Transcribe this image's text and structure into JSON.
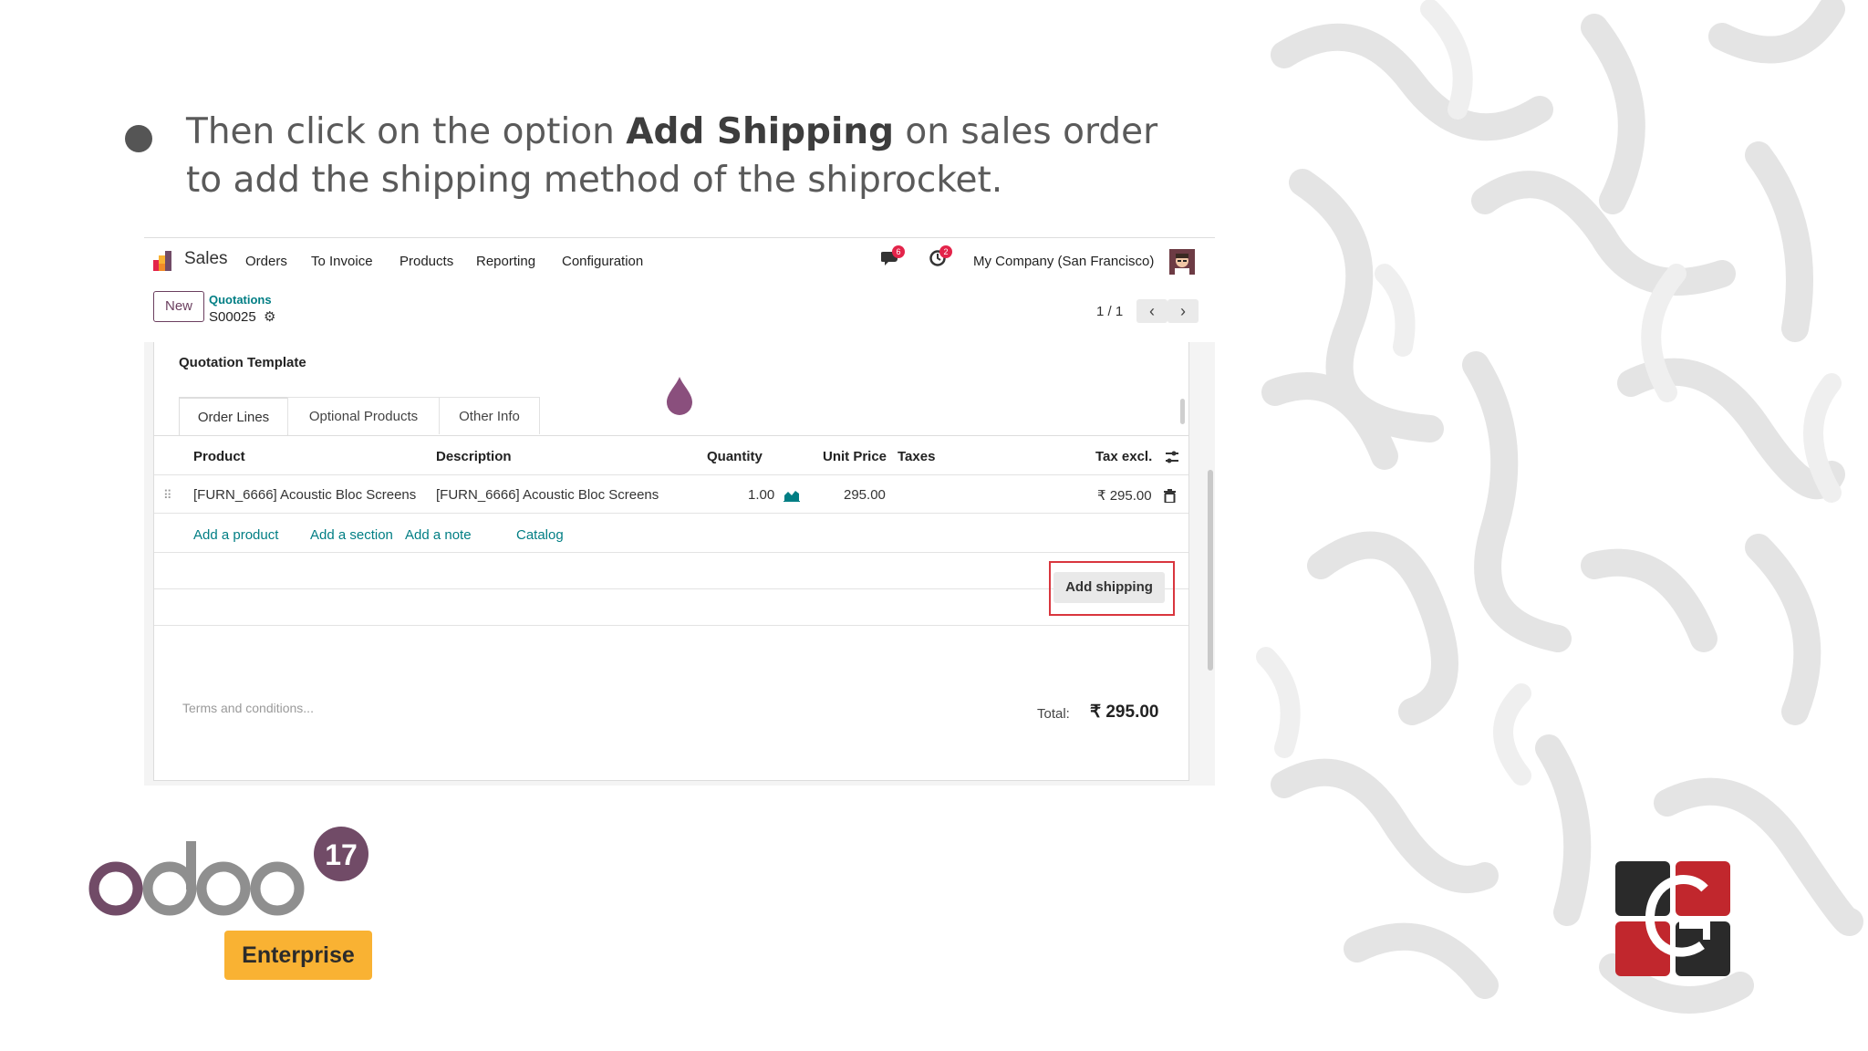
{
  "instruction": {
    "part1": "Then click on the option ",
    "bold": "Add Shipping",
    "part2": " on sales order to add the shipping method of the shiprocket."
  },
  "topbar": {
    "app_name": "Sales",
    "menu": [
      "Orders",
      "To Invoice",
      "Products",
      "Reporting",
      "Configuration"
    ],
    "messages_count": "6",
    "activities_count": "2",
    "company": "My Company (San Francisco)"
  },
  "control": {
    "new_label": "New",
    "breadcrumb_parent": "Quotations",
    "breadcrumb_current": "S00025",
    "pager": "1 / 1"
  },
  "form": {
    "quotation_template_label": "Quotation Template",
    "tabs": [
      "Order Lines",
      "Optional Products",
      "Other Info"
    ],
    "columns": {
      "product": "Product",
      "description": "Description",
      "quantity": "Quantity",
      "unit_price": "Unit Price",
      "taxes": "Taxes",
      "tax_excl": "Tax excl."
    },
    "lines": [
      {
        "product": "[FURN_6666] Acoustic Bloc Screens",
        "description": "[FURN_6666] Acoustic Bloc Screens",
        "quantity": "1.00",
        "unit_price": "295.00",
        "subtotal": "₹ 295.00"
      }
    ],
    "add_links": {
      "product": "Add a product",
      "section": "Add a section",
      "note": "Add a note",
      "catalog": "Catalog"
    },
    "terms_placeholder": "Terms and conditions...",
    "add_shipping_label": "Add shipping",
    "total_label": "Total:",
    "total_value": "₹ 295.00"
  },
  "logos": {
    "odoo_wordmark": "odoo",
    "odoo_version": "17",
    "edition": "Enterprise"
  },
  "colors": {
    "odoo_purple": "#714B67",
    "teal_link": "#017e84",
    "highlight_red": "#d9363e",
    "enterprise_yellow": "#f9b233"
  }
}
